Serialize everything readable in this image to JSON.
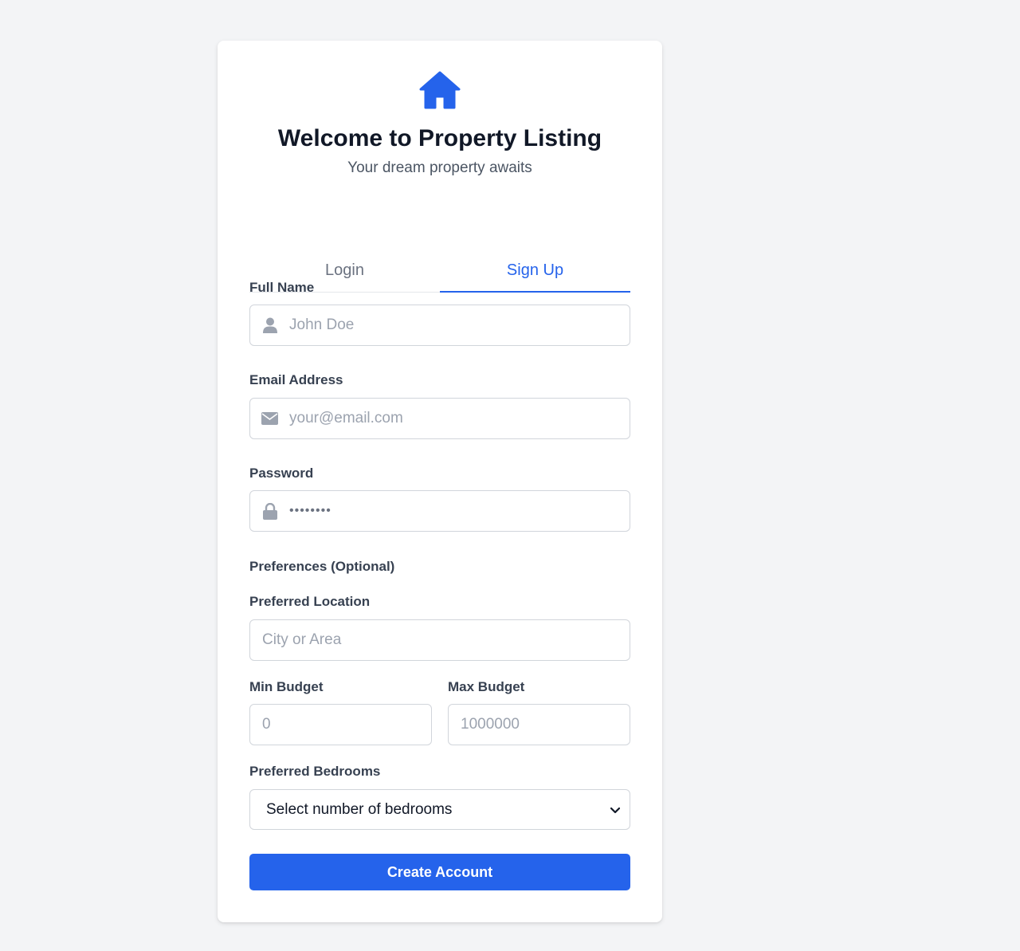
{
  "header": {
    "logo_icon": "house-icon",
    "title": "Welcome to Property Listing",
    "subtitle": "Your dream property awaits"
  },
  "tabs": [
    {
      "label": "Login",
      "active": false
    },
    {
      "label": "Sign Up",
      "active": true
    }
  ],
  "form": {
    "full_name": {
      "label": "Full Name",
      "placeholder": "John Doe",
      "icon": "user-icon"
    },
    "email": {
      "label": "Email Address",
      "placeholder": "your@email.com",
      "icon": "envelope-icon"
    },
    "password": {
      "label": "Password",
      "placeholder": "••••••••",
      "icon": "lock-icon"
    },
    "preferences_heading": "Preferences (Optional)",
    "location": {
      "label": "Preferred Location",
      "placeholder": "City or Area"
    },
    "min_budget": {
      "label": "Min Budget",
      "placeholder": "0"
    },
    "max_budget": {
      "label": "Max Budget",
      "placeholder": "1000000"
    },
    "bedrooms": {
      "label": "Preferred Bedrooms",
      "selected": "Select number of bedrooms"
    },
    "submit_label": "Create Account"
  },
  "colors": {
    "accent": "#2563eb",
    "background": "#f3f4f6",
    "card": "#ffffff",
    "border": "#d1d5db"
  }
}
